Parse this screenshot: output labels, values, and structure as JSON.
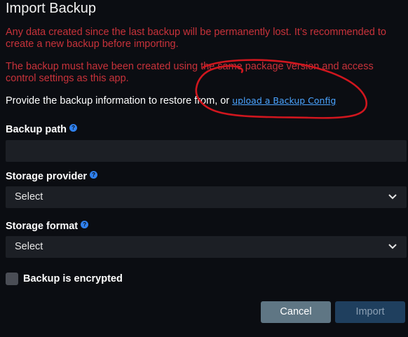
{
  "dialog": {
    "title": "Import Backup",
    "warning_1": "Any data created since the last backup will be permanently lost. It’s recommended to create a new backup before importing.",
    "warning_2": "The backup must have been created using the same package version and access control settings as this app.",
    "provide_text": "Provide the backup information to restore from, or ",
    "upload_link": "upload a Backup Config"
  },
  "fields": {
    "backup_path": {
      "label": "Backup path",
      "value": ""
    },
    "storage_provider": {
      "label": "Storage provider",
      "selected": "Select"
    },
    "storage_format": {
      "label": "Storage format",
      "selected": "Select"
    }
  },
  "encrypted": {
    "label": "Backup is encrypted",
    "checked": false
  },
  "buttons": {
    "cancel": "Cancel",
    "import": "Import"
  },
  "icons": {
    "info": "info-icon",
    "chevron": "chevron-down-icon"
  },
  "colors": {
    "warning": "#c8323a",
    "link": "#4aa3ff",
    "info_icon": "#2f80ed",
    "annotation": "#d0161e",
    "cancel_button": "#5f7684",
    "import_button": "#1f3f5e"
  }
}
